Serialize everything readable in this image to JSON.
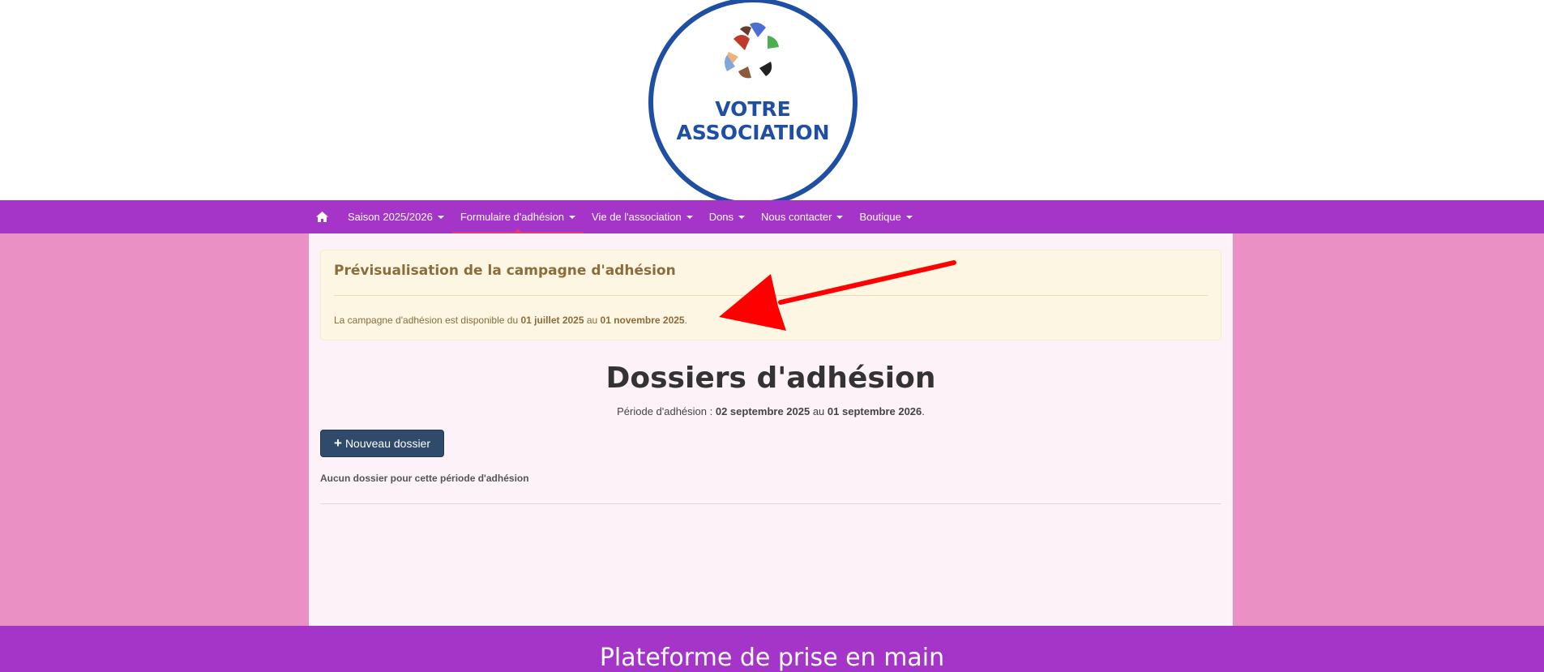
{
  "logo": {
    "line1": "VOTRE",
    "line2": "ASSOCIATION"
  },
  "nav": {
    "home_icon": "home-icon",
    "items": [
      {
        "label": "Saison 2025/2026"
      },
      {
        "label": "Formulaire d'adhésion"
      },
      {
        "label": "Vie de l'association"
      },
      {
        "label": "Dons"
      },
      {
        "label": "Nous contacter"
      },
      {
        "label": "Boutique"
      }
    ]
  },
  "alert": {
    "title": "Prévisualisation de la campagne d'adhésion",
    "text_prefix": "La campagne d'adhésion est disponible du ",
    "start_date": "01 juillet 2025",
    "text_middle": " au ",
    "end_date": "01 novembre 2025",
    "text_suffix": "."
  },
  "main": {
    "title": "Dossiers d'adhésion",
    "period_prefix": "Période d'adhésion : ",
    "period_start": "02 septembre 2025",
    "period_middle": " au ",
    "period_end": "01 septembre 2026",
    "period_suffix": ".",
    "new_button_label": "Nouveau dossier",
    "empty_note": "Aucun dossier pour cette période d'adhésion"
  },
  "footer": {
    "title": "Plateforme de prise en main"
  },
  "colors": {
    "nav_bg": "#a535c8",
    "page_bg": "#ea90c4",
    "content_bg": "#fcf2f8",
    "alert_bg": "#fcf6e3",
    "alert_text": "#8a6d3b",
    "button_bg": "#2f4a6b",
    "arrow": "#ff0000",
    "logo_blue": "#1f4fa3"
  }
}
